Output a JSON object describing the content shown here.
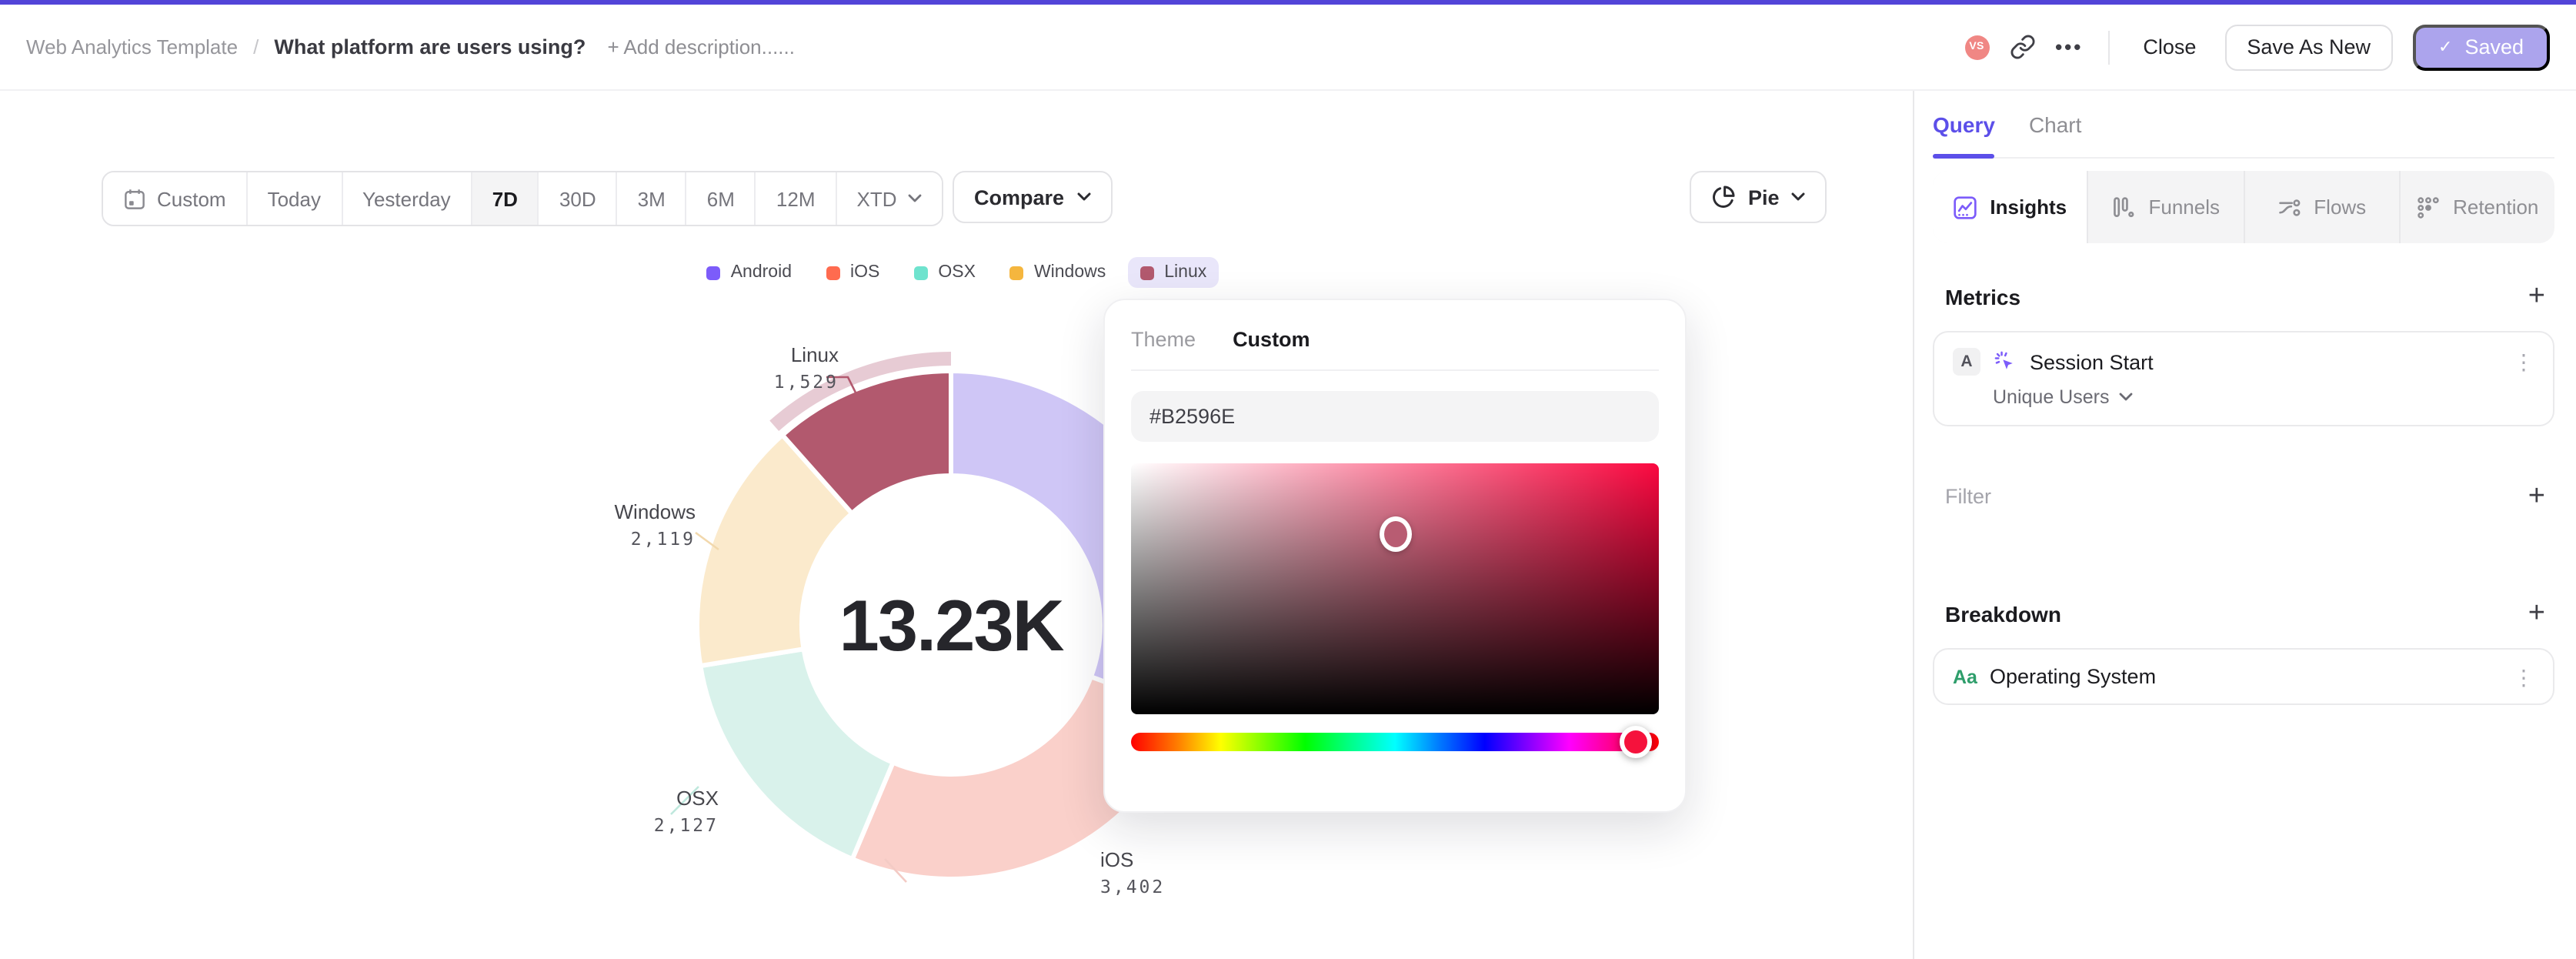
{
  "header": {
    "breadcrumb": {
      "root": "Web Analytics Template",
      "separator": "/",
      "title": "What platform are users using?",
      "add_description": "+ Add description......"
    },
    "avatar_initials": "VS",
    "ellipsis": "•••",
    "close_label": "Close",
    "save_as_new_label": "Save As New",
    "saved_label": "Saved",
    "saved_check": "✓",
    "accent_color": "#5244D8",
    "saved_button_color": "#ACA4ED"
  },
  "toolbar": {
    "date_ranges": [
      "Custom",
      "Today",
      "Yesterday",
      "7D",
      "30D",
      "3M",
      "6M",
      "12M",
      "XTD"
    ],
    "active_range": "7D",
    "compare_label": "Compare",
    "chart_type_label": "Pie"
  },
  "legend": {
    "items": [
      {
        "label": "Android",
        "color": "#7C5CFA",
        "highlighted": false
      },
      {
        "label": "iOS",
        "color": "#FF6B4F",
        "highlighted": false
      },
      {
        "label": "OSX",
        "color": "#6FE3CE",
        "highlighted": false
      },
      {
        "label": "Windows",
        "color": "#F5B63E",
        "highlighted": false
      },
      {
        "label": "Linux",
        "color": "#B2596E",
        "highlighted": true
      }
    ]
  },
  "chart_data": {
    "type": "pie",
    "donut": true,
    "title": "",
    "center_label": "13.23K",
    "total": 13230,
    "legend_position": "top",
    "series": [
      {
        "name": "Android",
        "value": 4053,
        "display": "",
        "color": "#7C5CFA",
        "muted_color": "#CFC6F6",
        "state": "dimmed",
        "label_visible": false
      },
      {
        "name": "iOS",
        "value": 3402,
        "display": "3,402",
        "color": "#FF6B4F",
        "muted_color": "#FAD0CA",
        "state": "dimmed",
        "label_visible": true
      },
      {
        "name": "OSX",
        "value": 2127,
        "display": "2,127",
        "color": "#6FE3CE",
        "muted_color": "#D9F2EB",
        "state": "dimmed",
        "label_visible": true
      },
      {
        "name": "Windows",
        "value": 2119,
        "display": "2,119",
        "color": "#F5B63E",
        "muted_color": "#FBEACC",
        "state": "dimmed",
        "label_visible": true
      },
      {
        "name": "Linux",
        "value": 1529,
        "display": "1,529",
        "color": "#B2596E",
        "muted_color": "#E7CBD4",
        "state": "selected",
        "label_visible": true
      }
    ]
  },
  "color_picker": {
    "tabs": [
      "Theme",
      "Custom"
    ],
    "active_tab": "Custom",
    "hex_value": "#B2596E",
    "marker_color": "#B85C72",
    "hue_thumb_color": "#F5123C",
    "hue_thumb_position_pct": 95.5
  },
  "sidebar": {
    "tabs": [
      {
        "label": "Query",
        "active": true
      },
      {
        "label": "Chart",
        "active": false
      }
    ],
    "mode_tabs": [
      {
        "label": "Insights",
        "active": true
      },
      {
        "label": "Funnels",
        "active": false
      },
      {
        "label": "Flows",
        "active": false
      },
      {
        "label": "Retention",
        "active": false
      }
    ],
    "metrics": {
      "heading": "Metrics",
      "add_label": "+",
      "items": [
        {
          "badge": "A",
          "label": "Session Start",
          "aggregation": "Unique Users",
          "menu": "⋮"
        }
      ]
    },
    "filter": {
      "heading": "Filter",
      "add_label": "+"
    },
    "breakdown": {
      "heading": "Breakdown",
      "add_label": "+",
      "items": [
        {
          "badge": "Aa",
          "label": "Operating System",
          "menu": "⋮"
        }
      ]
    }
  }
}
